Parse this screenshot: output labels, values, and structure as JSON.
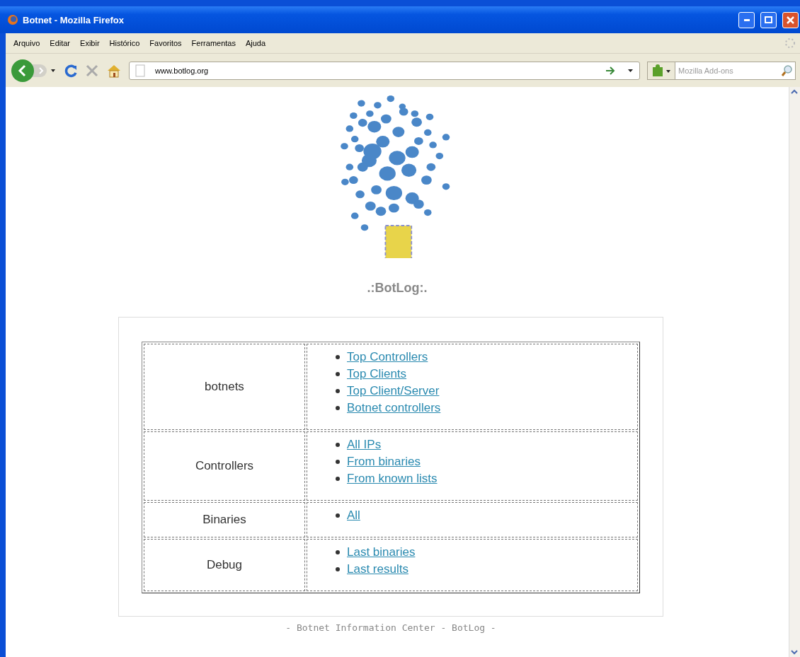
{
  "window": {
    "title": "Botnet - Mozilla Firefox"
  },
  "menu": [
    "Arquivo",
    "Editar",
    "Exibir",
    "Histórico",
    "Favoritos",
    "Ferramentas",
    "Ajuda"
  ],
  "toolbar": {
    "url": "www.botlog.org",
    "search_placeholder": "Mozilla Add-ons"
  },
  "page": {
    "heading": ".:BotLog:.",
    "sections": [
      {
        "label": "botnets",
        "links": [
          "Top Controllers",
          "Top Clients",
          "Top Client/Server",
          "Botnet controllers"
        ]
      },
      {
        "label": "Controllers",
        "links": [
          "All IPs",
          "From binaries",
          "From known lists"
        ]
      },
      {
        "label": "Binaries",
        "links": [
          "All"
        ]
      },
      {
        "label": "Debug",
        "links": [
          "Last binaries",
          "Last results"
        ]
      }
    ],
    "footer": "- Botnet Information Center - BotLog -"
  }
}
